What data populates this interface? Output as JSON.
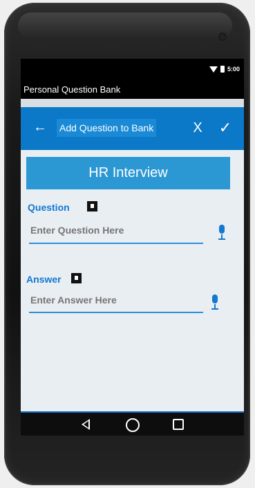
{
  "status_bar": {
    "time": "5:00"
  },
  "app": {
    "title": "Personal Question Bank"
  },
  "toolbar": {
    "back_icon": "arrow-left-icon",
    "title": "Add Question to Bank",
    "close_label": "X",
    "confirm_icon": "check-icon"
  },
  "category": {
    "name": "HR Interview"
  },
  "question": {
    "label": "Question",
    "placeholder": "Enter Question Here",
    "icon": "note-icon",
    "mic_icon": "microphone-icon"
  },
  "answer": {
    "label": "Answer",
    "placeholder": "Enter Answer Here",
    "icon": "note-icon",
    "mic_icon": "microphone-icon"
  },
  "nav": {
    "back_icon": "triangle-back-icon",
    "home_icon": "circle-home-icon",
    "recents_icon": "square-recents-icon"
  },
  "colors": {
    "primary": "#0b78c8",
    "banner": "#2c98d3",
    "label": "#1278d0",
    "placeholder": "#c8cdd2"
  }
}
